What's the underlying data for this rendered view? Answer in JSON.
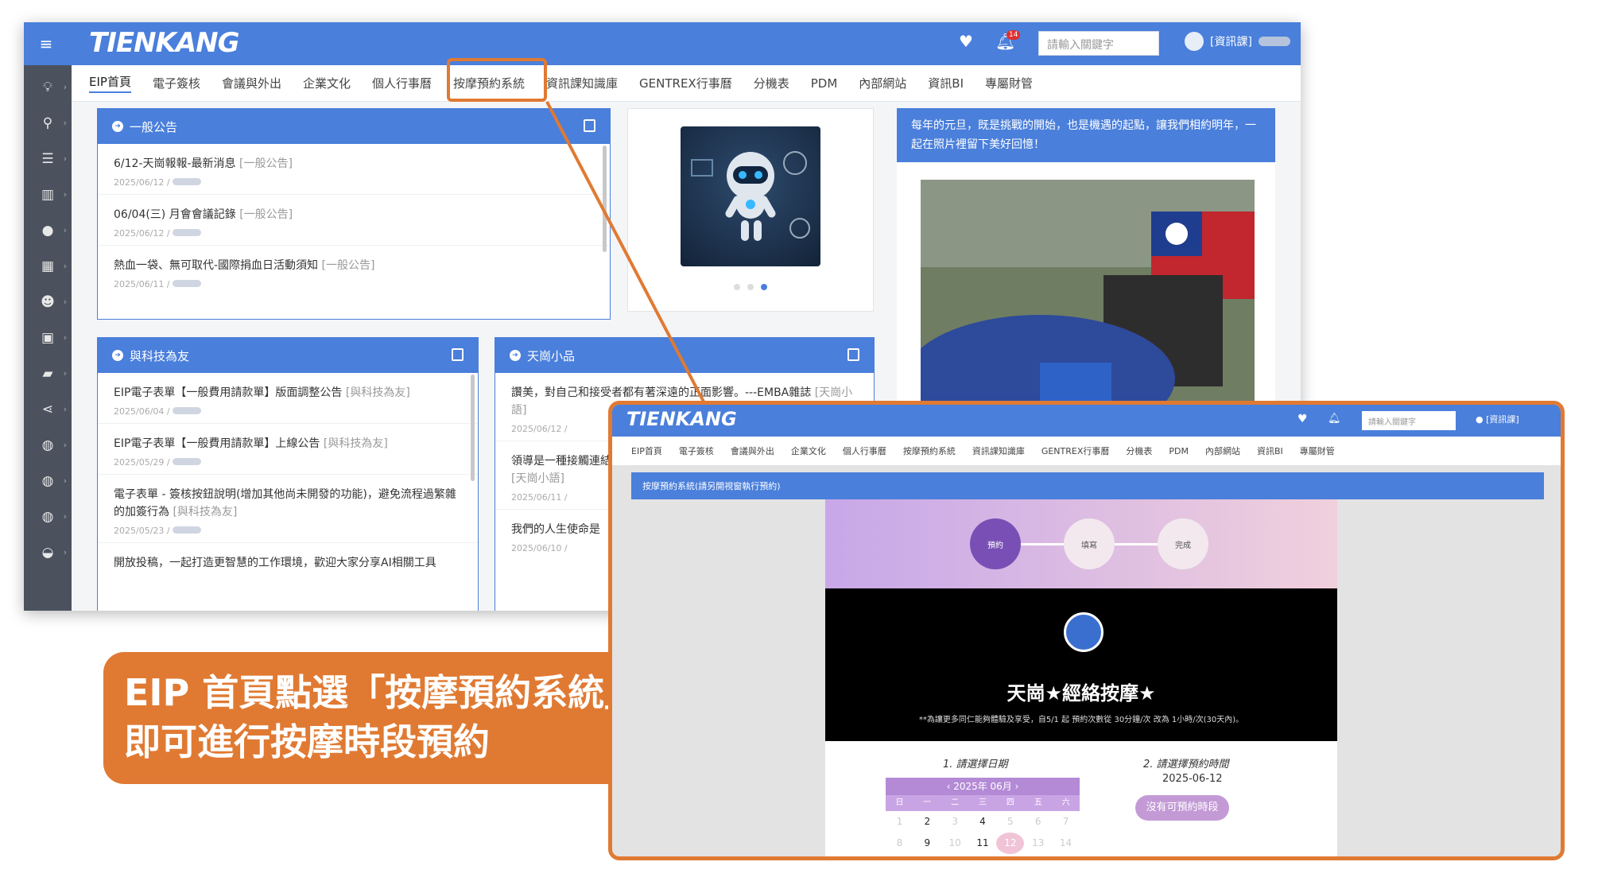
{
  "brand": {
    "logo": "TIENKANG"
  },
  "topbar": {
    "search_placeholder": "請輸入關鍵字",
    "notif_count": "14",
    "user_dept": "[資訊課]"
  },
  "nav": [
    "EIP首頁",
    "電子簽核",
    "會議與外出",
    "企業文化",
    "個人行事曆",
    "按摩預約系統",
    "資訊課知識庫",
    "GENTREX行事曆",
    "分機表",
    "PDM",
    "內部網站",
    "資訊BI",
    "專屬財管"
  ],
  "panels": {
    "announce": {
      "title": "一般公告",
      "items": [
        {
          "title": "6/12-天崗報報-最新消息",
          "tag": "[一般公告]",
          "date": "2025/06/12 /"
        },
        {
          "title": "06/04(三) 月會會議記錄",
          "tag": "[一般公告]",
          "date": "2025/06/12 /"
        },
        {
          "title": "熱血一袋、無可取代-國際捐血日活動須知",
          "tag": "[一般公告]",
          "date": "2025/06/11 /"
        }
      ]
    },
    "tech": {
      "title": "與科技為友",
      "items": [
        {
          "title": "EIP電子表單【一般費用請款單】版面調整公告",
          "tag": "[與科技為友]",
          "date": "2025/06/04 /"
        },
        {
          "title": "EIP電子表單【一般費用請款單】上線公告",
          "tag": "[與科技為友]",
          "date": "2025/05/29 /"
        },
        {
          "title": "電子表單 - 簽核按鈕說明(增加其他尚未開發的功能)，避免流程過繁雜的加簽行為",
          "tag": "[與科技為友]",
          "date": "2025/05/23 /"
        },
        {
          "title": "開放投稿，一起打造更智慧的工作環境，歡迎大家分享AI相關工具",
          "tag": "",
          "date": ""
        }
      ]
    },
    "essay": {
      "title": "天崗小品",
      "items": [
        {
          "title": "讚美，對自己和接受者都有著深遠的正面影響。---EMBA雜誌",
          "tag": "[天崗小語]",
          "date": "2025/06/12 /"
        },
        {
          "title": "領導是一種接觸連結的管理課",
          "tag": "[天崗小語]",
          "date": "2025/06/11 /"
        },
        {
          "title": "我們的人生使命是",
          "tag": "",
          "date": "2025/06/10 /"
        }
      ]
    },
    "newyear": {
      "text": "每年的元旦，既是挑戰的開始，也是機遇的起點，讓我們相約明年，一起在照片裡留下美好回憶！"
    }
  },
  "callout": {
    "line1": "EIP 首頁點選「按摩預約系統」",
    "line2": "即可進行按摩時段預約"
  },
  "booking_window": {
    "header": "按摩預約系統(請另開視窗執行預約)",
    "steps": [
      "預約",
      "填寫",
      "完成"
    ],
    "title": "天崗★經絡按摩★",
    "subtitle": "**為讓更多同仁能夠體驗及享受，自5/1 起 預約次數從 30分鐘/次 改為 1小時/次(30天內)。",
    "date_label": "1. 請選擇日期",
    "time_label": "2. 請選擇預約時間",
    "selected_date": "2025-06-12",
    "month": "2025年 06月",
    "dow": [
      "日",
      "一",
      "二",
      "三",
      "四",
      "五",
      "六"
    ],
    "no_slot": "沒有可預約時段"
  },
  "colors": {
    "accent": "#4a7fdb",
    "callout": "#e07a33",
    "sidebar": "#4b525e"
  }
}
